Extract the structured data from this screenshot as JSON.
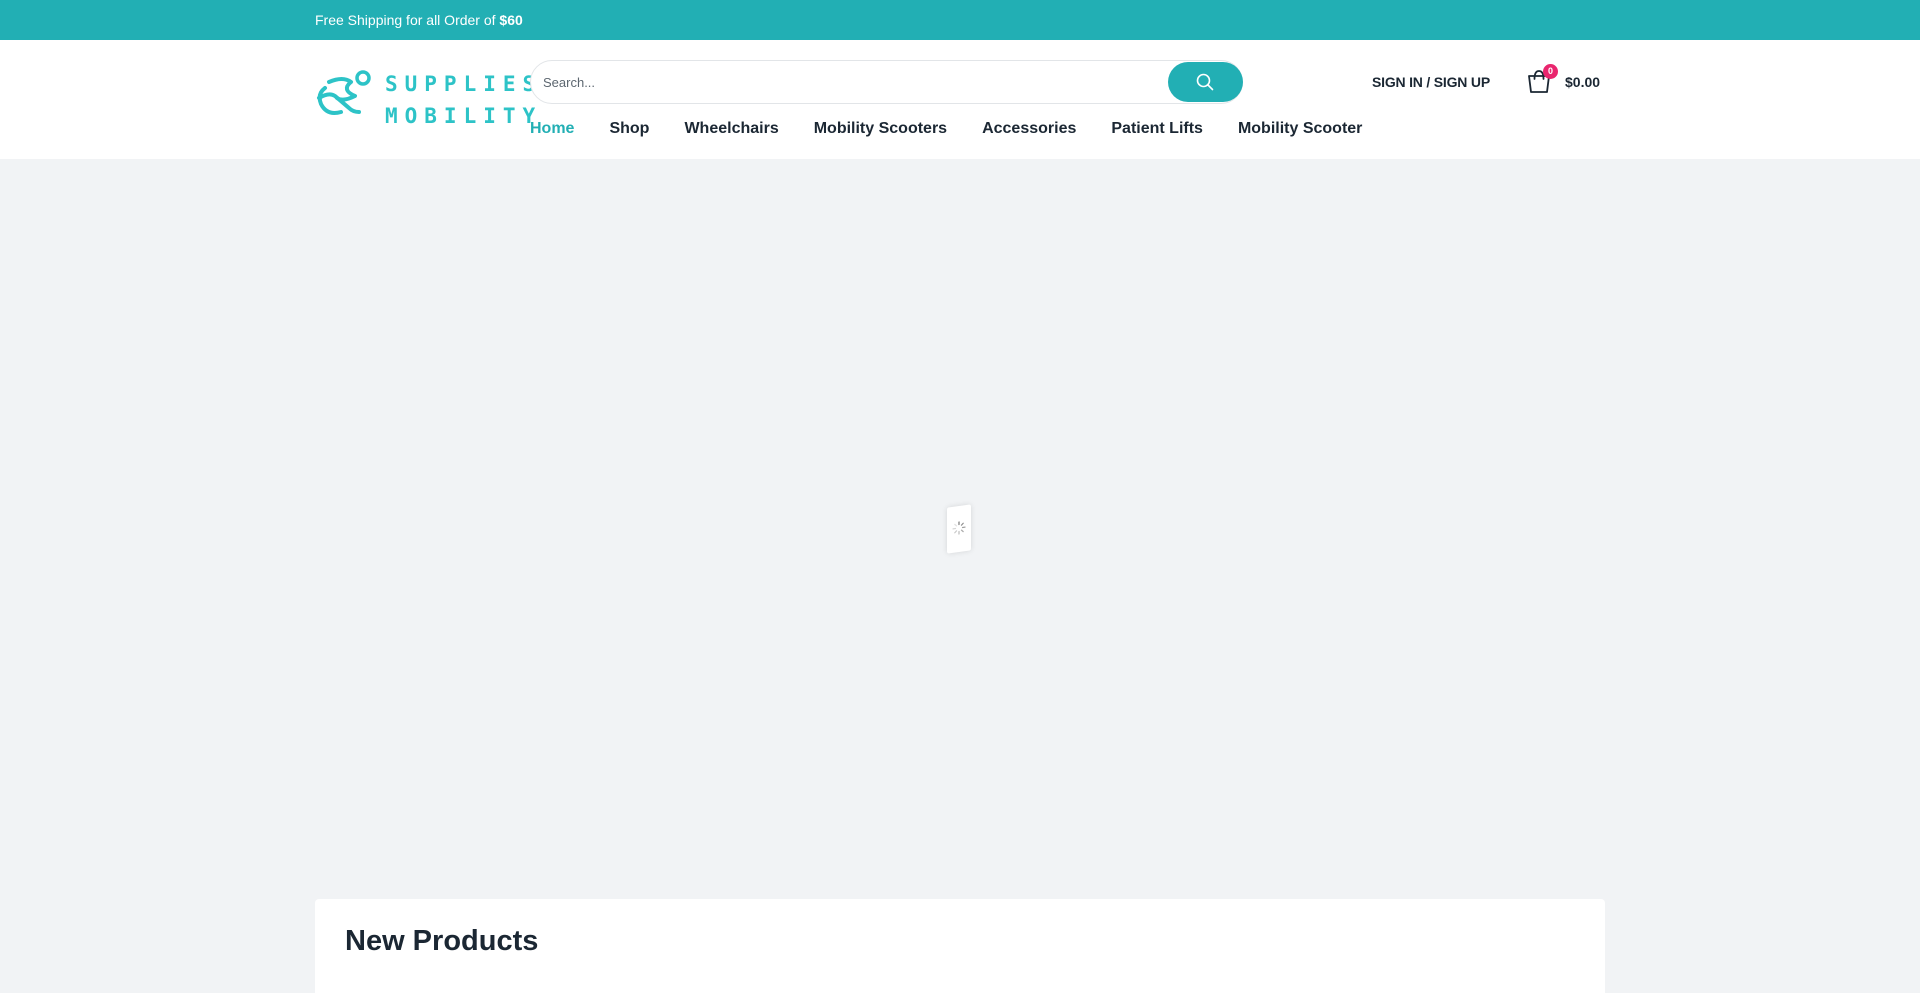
{
  "topbar": {
    "text": "Free Shipping for all Order of ",
    "amount": "$60"
  },
  "logo": {
    "line1": "SUPPLIES",
    "line2": "MOBILITY",
    "icon": "wheelchair-swirl-icon"
  },
  "search": {
    "placeholder": "Search...",
    "button_icon": "search-icon"
  },
  "account": {
    "signin_label": "SIGN IN / SIGN UP"
  },
  "cart": {
    "icon": "shopping-bag-icon",
    "count": "0",
    "total": "$0.00"
  },
  "nav": {
    "items": [
      {
        "label": "Home",
        "active": true
      },
      {
        "label": "Shop",
        "active": false
      },
      {
        "label": "Wheelchairs",
        "active": false
      },
      {
        "label": "Mobility Scooters",
        "active": false
      },
      {
        "label": "Accessories",
        "active": false
      },
      {
        "label": "Patient Lifts",
        "active": false
      },
      {
        "label": "Mobility Scooter",
        "active": false
      }
    ]
  },
  "loader": {
    "icon": "spinner-icon"
  },
  "sections": {
    "new_products_title": "New Products"
  },
  "colors": {
    "accent": "#22afb4",
    "badge": "#e9266e",
    "background": "#f1f3f5",
    "text": "#1b2733"
  }
}
